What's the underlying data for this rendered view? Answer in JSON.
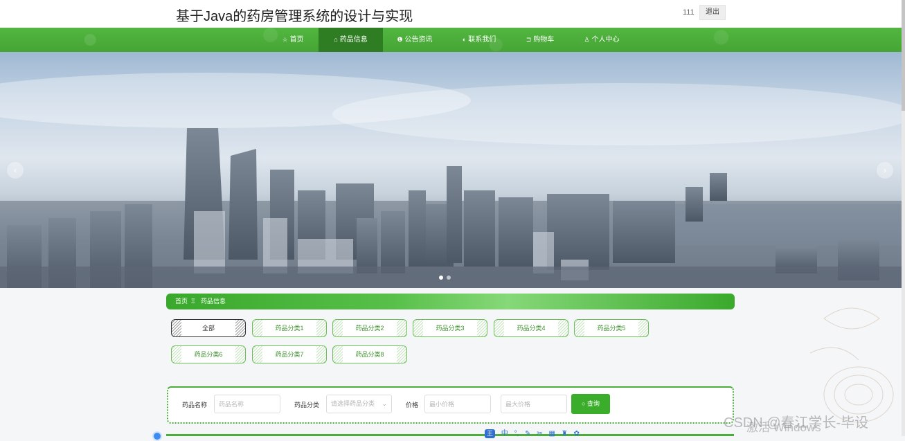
{
  "header": {
    "site_title": "基于Java的药房管理系统的设计与实现",
    "username": "111",
    "logout_label": "退出"
  },
  "nav": {
    "items": [
      {
        "label": "首页",
        "icon": "star-icon",
        "glyph": "☆"
      },
      {
        "label": "药品信息",
        "icon": "bag-icon",
        "glyph": "⌂"
      },
      {
        "label": "公告资讯",
        "icon": "info-icon",
        "glyph": "❶"
      },
      {
        "label": "联系我们",
        "icon": "phone-icon",
        "glyph": "◐"
      },
      {
        "label": "购物车",
        "icon": "cart-icon",
        "glyph": "⊐"
      },
      {
        "label": "个人中心",
        "icon": "user-icon",
        "glyph": "♙"
      }
    ],
    "active_index": 1
  },
  "banner": {
    "prev_glyph": "‹",
    "next_glyph": "›",
    "slide_count": 2,
    "active_slide": 0
  },
  "breadcrumb": {
    "home": "首页",
    "separator": "Ξ",
    "current": "药品信息"
  },
  "categories": {
    "items": [
      "全部",
      "药品分类1",
      "药品分类2",
      "药品分类3",
      "药品分类4",
      "药品分类5",
      "药品分类6",
      "药品分类7",
      "药品分类8"
    ],
    "active_index": 0
  },
  "search": {
    "name_label": "药品名称",
    "name_placeholder": "药品名称",
    "category_label": "药品分类",
    "category_placeholder": "请选择药品分类",
    "price_label": "价格",
    "min_price_placeholder": "最小价格",
    "max_price_placeholder": "最大价格",
    "query_label": "查询",
    "query_glyph": "○"
  },
  "ime_toolbar": {
    "logo": "王",
    "items": [
      "中",
      "°,",
      "✎",
      "✂",
      "▦",
      "♜",
      "✿"
    ]
  },
  "watermarks": {
    "windows": "激活 Windows",
    "csdn": "CSDN @春江学长-毕设"
  },
  "colors": {
    "brand_green": "#4cae3a",
    "nav_active": "#2e7d22",
    "button_green": "#3aae2a"
  }
}
